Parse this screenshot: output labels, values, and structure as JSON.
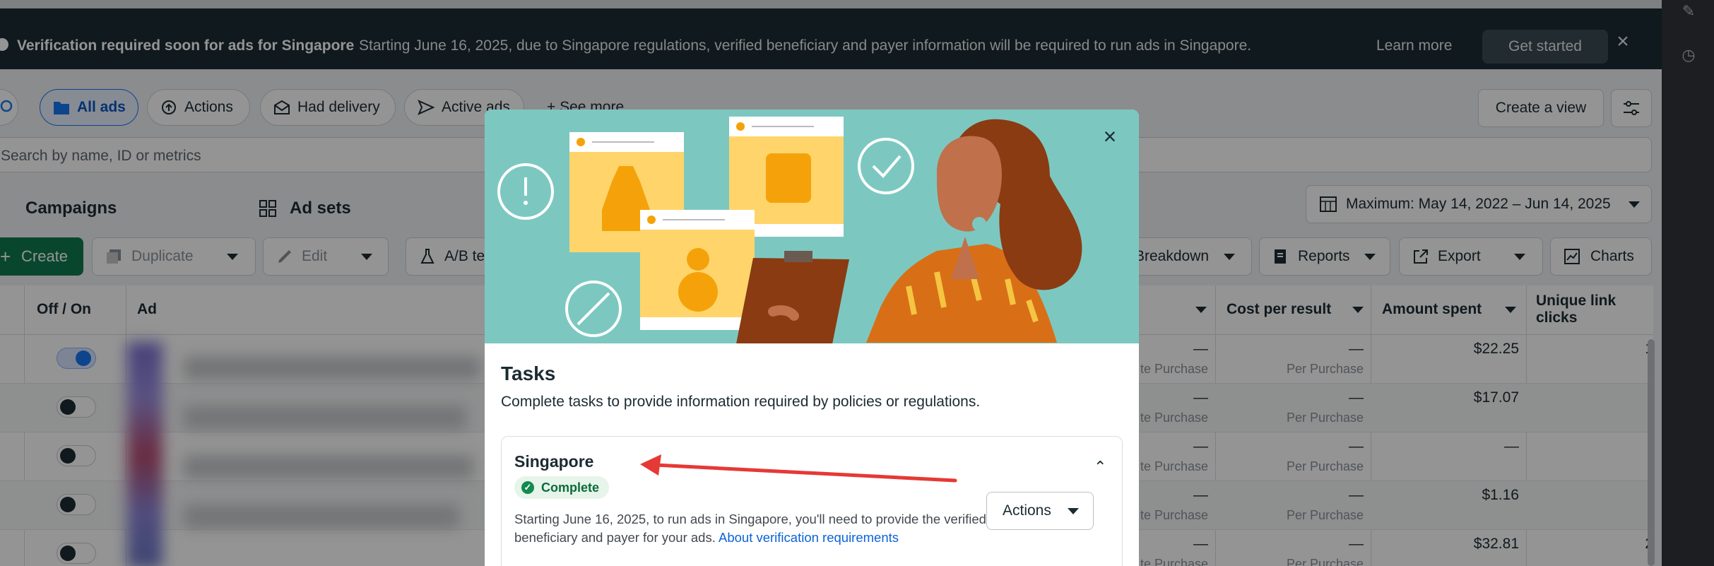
{
  "banner": {
    "title": "Verification required soon for ads for Singapore",
    "text": "Starting June 16, 2025, due to Singapore regulations, verified beneficiary and payer information will be required to run ads in Singapore.",
    "learn_more": "Learn more",
    "get_started": "Get started"
  },
  "filters": {
    "all_ads": "All ads",
    "actions": "Actions",
    "had_delivery": "Had delivery",
    "active_ads": "Active ads",
    "see_more": "See more",
    "create_view": "Create a view"
  },
  "search": {
    "placeholder": "Search by name, ID or metrics"
  },
  "tabs": {
    "campaigns": "Campaigns",
    "ad_sets": "Ad sets"
  },
  "date_range": "Maximum: May 14, 2022 – Jun 14, 2025",
  "toolbar": {
    "create": "Create",
    "duplicate": "Duplicate",
    "edit": "Edit",
    "ab_test": "A/B te",
    "breakdown": "Breakdown",
    "reports": "Reports",
    "export": "Export",
    "charts": "Charts"
  },
  "table": {
    "headers": {
      "off_on": "Off / On",
      "ad": "Ad",
      "cost_per_result": "Cost per result",
      "amount_spent": "Amount spent",
      "unique_link_clicks_1": "Unique link",
      "unique_link_clicks_2": "clicks"
    },
    "rows": [
      {
        "on": true,
        "results": "—",
        "results_sub": "te Purchase",
        "cost": "—",
        "cost_sub": "Per Purchase",
        "spent": "$22.25",
        "clicks": "1"
      },
      {
        "on": false,
        "results": "—",
        "results_sub": "te Purchase",
        "cost": "—",
        "cost_sub": "Per Purchase",
        "spent": "$17.07",
        "clicks": ""
      },
      {
        "on": false,
        "results": "—",
        "results_sub": "te Purchase",
        "cost": "—",
        "cost_sub": "Per Purchase",
        "spent": "—",
        "clicks": "-"
      },
      {
        "on": false,
        "results": "—",
        "results_sub": "te Purchase",
        "cost": "—",
        "cost_sub": "Per Purchase",
        "spent": "$1.16",
        "clicks": ""
      },
      {
        "on": false,
        "results": "—",
        "results_sub": "te Purchase",
        "cost": "—",
        "cost_sub": "Per Purchase",
        "spent": "$32.81",
        "clicks": "2"
      }
    ]
  },
  "modal": {
    "title": "Tasks",
    "description": "Complete tasks to provide information required by policies or regulations.",
    "card": {
      "title": "Singapore",
      "status": "Complete",
      "body": "Starting June 16, 2025, to run ads in Singapore, you'll need to provide the verified beneficiary and payer for your ads.",
      "link": "About verification requirements",
      "actions": "Actions"
    }
  },
  "colors": {
    "brand_blue": "#1877f2",
    "create_green": "#0e7a4f",
    "banner_bg": "#1c2b33",
    "complete_green": "#138a4f",
    "annotation_red": "#e53935"
  }
}
